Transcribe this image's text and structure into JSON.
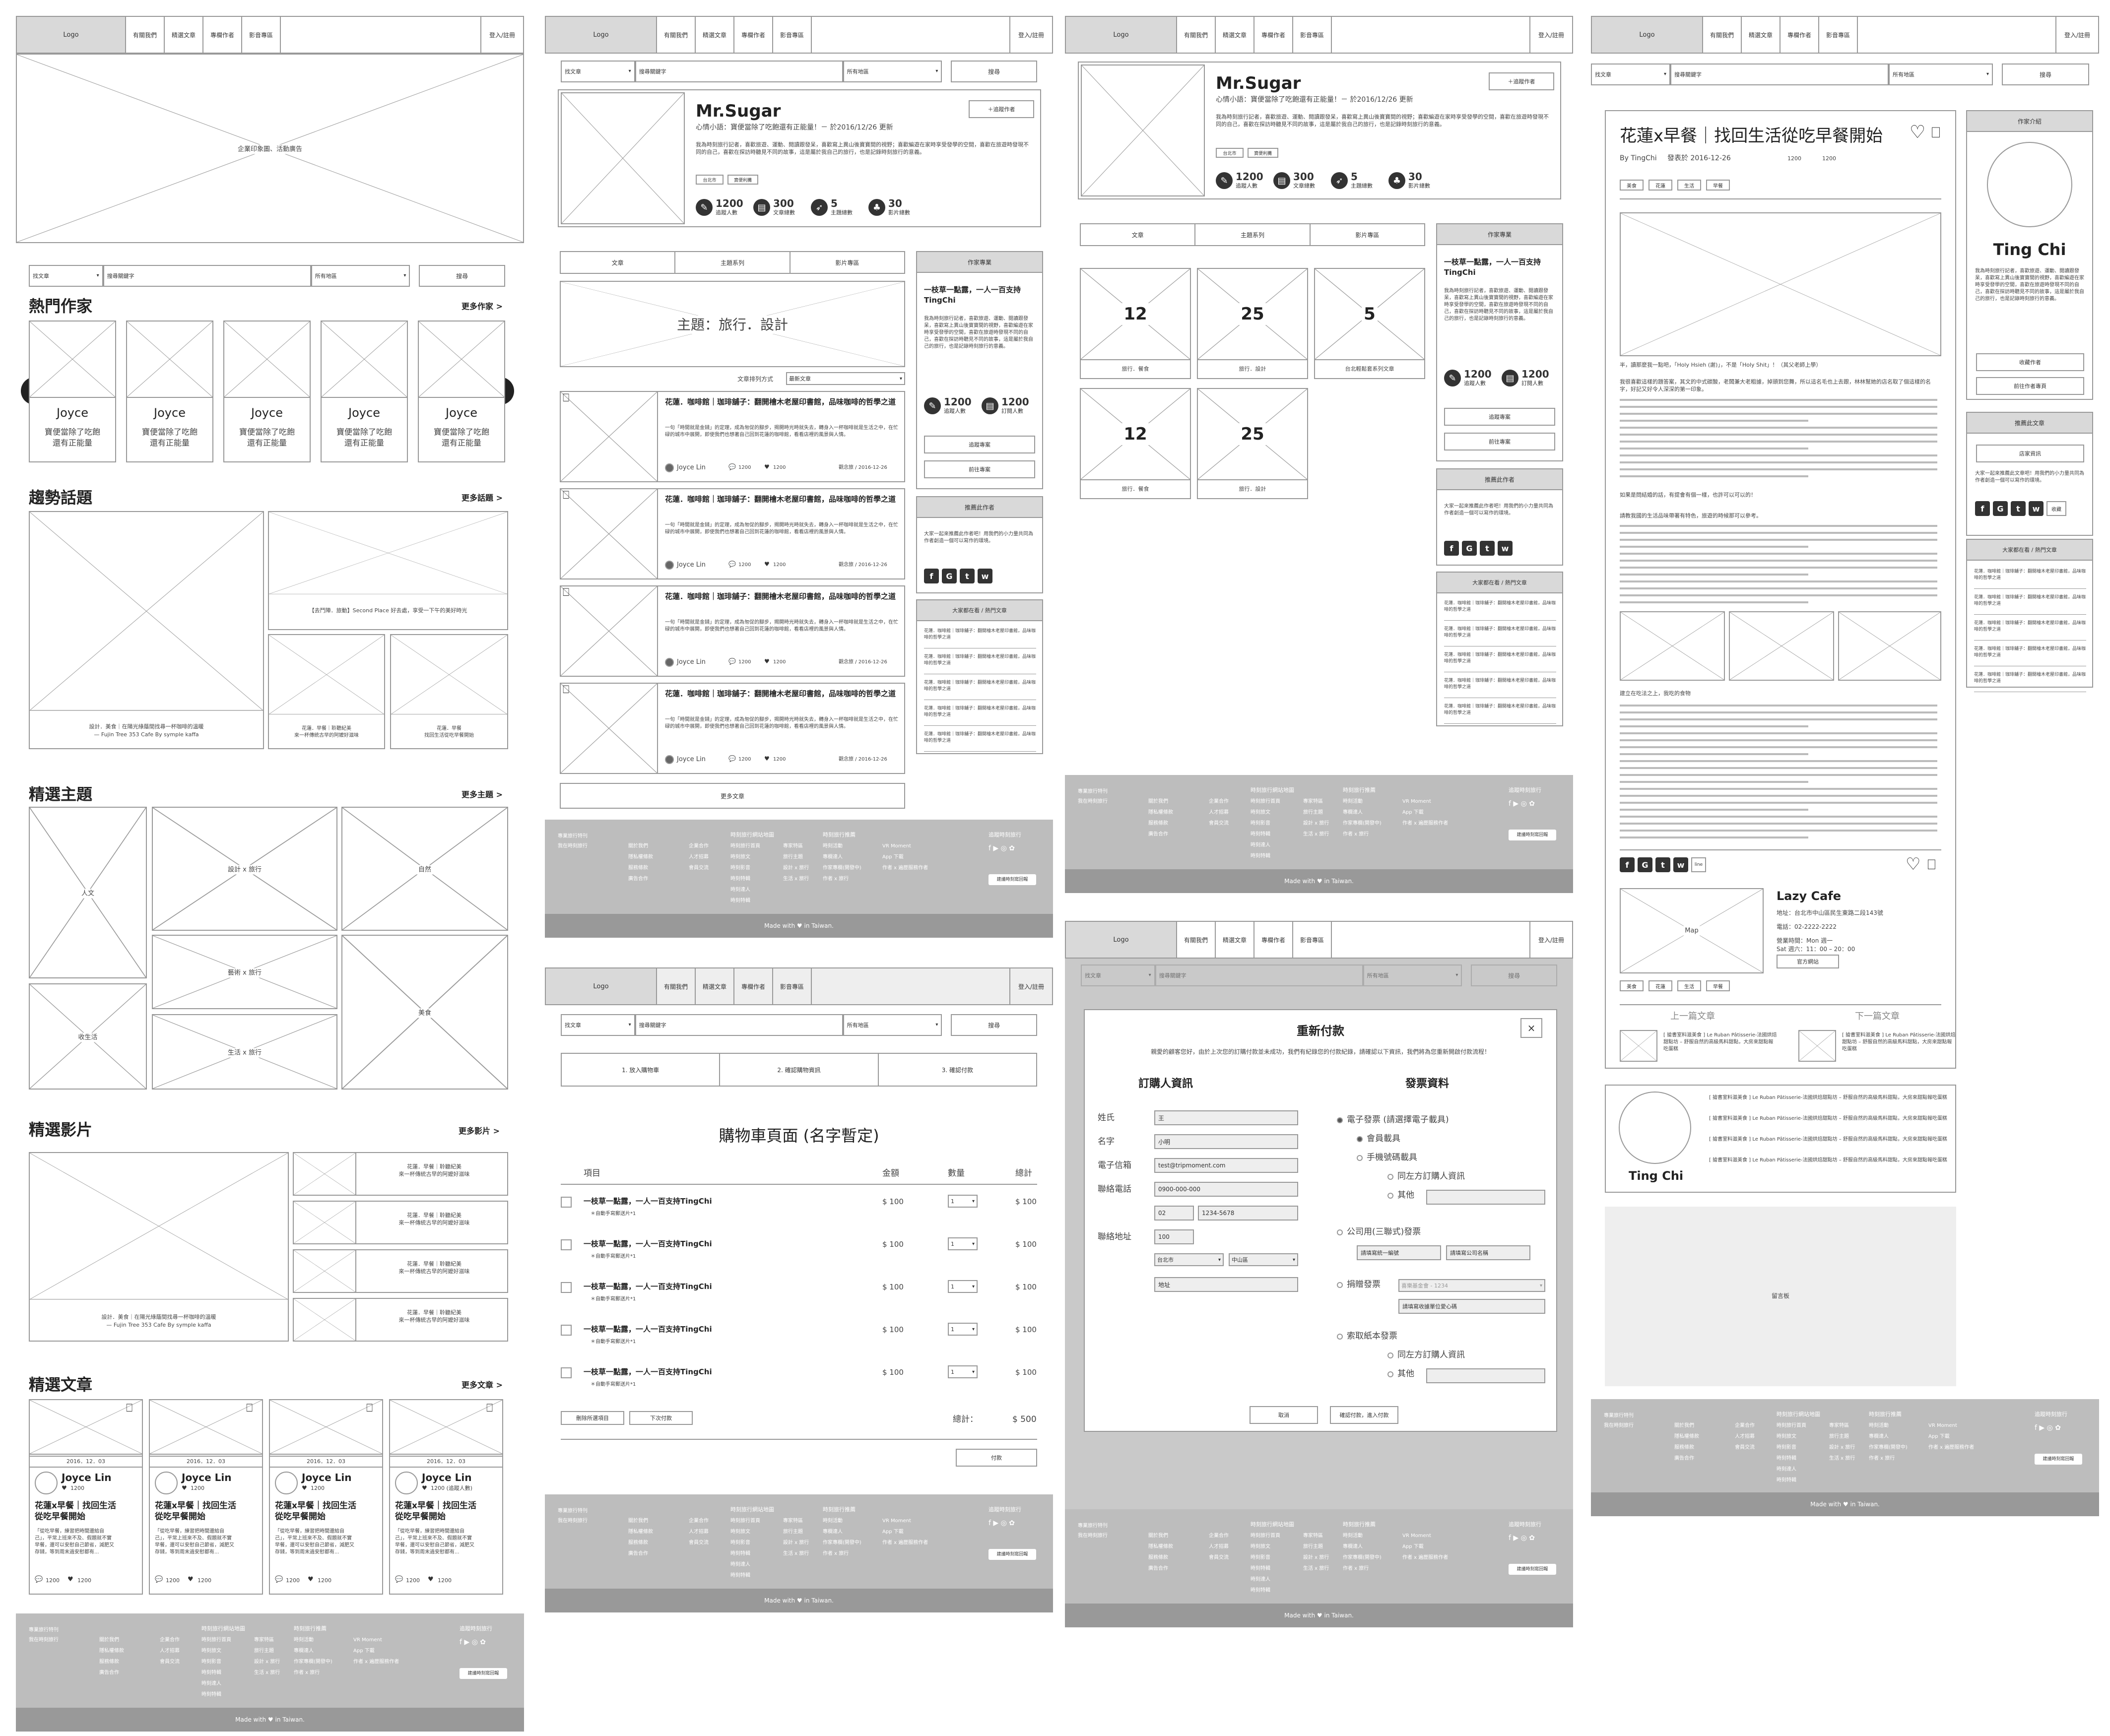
{
  "nav": {
    "logo": "Logo",
    "items": [
      "有關我們",
      "精選文章",
      "專欄作者",
      "影音專區"
    ],
    "login": "登入/註冊"
  },
  "search": {
    "type": "找文章",
    "keyword": "搜尋關鍵字",
    "region": "所有地區",
    "button": "搜尋"
  },
  "home": {
    "banner": "企業印象圖、活動廣告",
    "hot_title": "熱門作家",
    "hot_more": "更多作家 >",
    "writers": [
      {
        "name": "Joyce",
        "desc": "寶便當除了吃飽\n還有正能量"
      },
      {
        "name": "Joyce",
        "desc": "寶便當除了吃飽\n還有正能量"
      },
      {
        "name": "Joyce",
        "desc": "寶便當除了吃飽\n還有正能量"
      },
      {
        "name": "Joyce",
        "desc": "寶便當除了吃飽\n還有正能量"
      },
      {
        "name": "Joyce",
        "desc": "寶便當除了吃飽\n還有正能量"
      }
    ],
    "trend_title": "趨勢話題",
    "trend_more": "更多話題 >",
    "trend_main": "設計．美食｜在陽光綠蔭間找尋一杯咖啡的溫暖\n— Fujin Tree 353 Cafe By symple kaffa",
    "trend_right": "【去鬥陣．旅動】Second Place 好去處，享受一下午的美好時光",
    "trend_small1": "花蓮．早餐｜聆聽紀美\n來一杯傳統古早的阿嬤好滋味",
    "trend_small2": "花蓮．早餐\n找回生活從吃早餐開始",
    "theme_title": "精選主題",
    "theme_more": "更多主題 >",
    "themes": [
      "人文",
      "設計 x 旅行",
      "自然",
      "藝術 x 旅行",
      "美食",
      "收生活",
      "生活 x 旅行"
    ],
    "video_title": "精選影片",
    "video_more": "更多影片 >",
    "video_main": "設計．美食｜在陽光綠蔭間找尋一杯咖啡的溫暖\n— Fujin Tree 353 Cafe By symple kaffa",
    "video_item": "花蓮．早餐｜聆聽紀美\n來一杯傳統古早的阿嬤好滋味",
    "article_title": "精選文章",
    "article_more": "更多文章 >",
    "articles": [
      {
        "date": "2016．12．03",
        "author": "Joyce Lin",
        "count": "1200",
        "title": "花蓮x早餐｜找回生活\n從吃早餐開始",
        "excerpt": "「從吃早餐，練習把時間還給自\n己」，平常上班來不及、假題就不實\n早餐，還可以安慰自己節省，減肥又\n存錢，等到周末過安慰都有..."
      },
      {
        "date": "2016．12．03",
        "author": "Joyce Lin",
        "count": "1200",
        "title": "花蓮x早餐｜找回生活\n從吃早餐開始",
        "excerpt": "「從吃早餐，練習把時間還給自\n己」，平常上班來不及、假題就不實\n早餐，還可以安慰自己節省，減肥又\n存錢，等到周末過安慰都有..."
      },
      {
        "date": "2016．12．03",
        "author": "Joyce Lin",
        "count": "1200",
        "title": "花蓮x早餐｜找回生活\n從吃早餐開始",
        "excerpt": "「從吃早餐，練習把時間還給自\n己」，平常上班來不及、假題就不實\n早餐，還可以安慰自己節省，減肥又\n存錢，等到周末過安慰都有..."
      },
      {
        "date": "2016．12．03",
        "author": "Joyce Lin",
        "count": "1200 (追蹤人數)",
        "title": "花蓮x早餐｜找回生活\n從吃早餐開始",
        "excerpt": "「從吃早餐，練習把時間還給自\n己」，平常上班來不及、假題就不實\n早餐，還可以安慰自己節省，減肥又\n存錢，等到周末過安慰都有..."
      }
    ],
    "likes": "1200"
  },
  "footer": {
    "brand": "專業旅行特刊\n我在時刻旅行",
    "c1": [
      "關於我們",
      "隱私權條款",
      "服務條款",
      "廣告合作"
    ],
    "c2": [
      "企業合作",
      "人才招募",
      "會員交流"
    ],
    "h2": "時刻旅行網站地圖",
    "c3": [
      "時刻旅行首頁",
      "時刻旅文",
      "時刻影音",
      "時刻特輯",
      "時刻達人",
      "時刻特輯"
    ],
    "c4": [
      "專家特區",
      "旅行主題",
      "設計 x 旅行",
      "生活 x 旅行"
    ],
    "h3": "時刻旅行推薦",
    "c5": [
      "時刻活動",
      "專欄達人",
      "作家專欄(開發中)",
      "作者 x 旅行"
    ],
    "c6": [
      "VR Moment",
      "App 下載",
      "作者 x 遍歷服務作者"
    ],
    "h4": "追蹤時刻旅行",
    "sub": "建議時刻寫回報",
    "made": "Made with ♥ in Taiwan."
  },
  "author": {
    "name": "Mr.Sugar",
    "tagline": "心情小語：寶便當除了吃飽還有正能量！－ 於2016/12/26 更新",
    "follow": "＋追蹤作者",
    "bio": "我為時刻旅行記者，喜歡旅遊、運動、閱讀跟發呆，喜歡寫上異山後寶寶間的視野；喜歡編遊在家時享受發學的空間，喜歡在旅遊時發現不同的自己，喜歡在探訪時聽見不同的故事，這是屬於我自己的旅行，也是記錄時刻旅行的意義。",
    "tags": [
      "台北市",
      "寶便利攤"
    ],
    "stats": [
      {
        "v": "1200",
        "k": "追蹤人數"
      },
      {
        "v": "300",
        "k": "文章總數"
      },
      {
        "v": "5",
        "k": "主題總數"
      },
      {
        "v": "30",
        "k": "影片總數"
      }
    ],
    "tabs": [
      "文章",
      "主題系列",
      "影片專區"
    ],
    "theme_banner": "主題：旅行．設計",
    "sort_label": "文章排列方式",
    "sort": "最新文章",
    "post_title": "花蓮．咖啡館｜珈琲舖子：翻開檜木老屋印書館，品味咖啡的哲學之道",
    "post_excerpt": "一句「時間就是金錢」的定理，成為匆促的腳步，揭開時光時就失去，轉身入一杯咖啡就是生活之中，在忙碌的城市中展開，即使我們也想著自己回到花蓮的咖啡館，看看店裡的風景與人情。",
    "post_author": "Joyce Lin",
    "post_c": "1200",
    "post_l": "1200",
    "post_date": "觀念旅 / 2016-12-26",
    "more_articles": "更多文章",
    "side_head": "作家專業",
    "side_title": "一枝草一點露，一人一百支持 TingChi",
    "side_bio": "我為時刻旅行記者，喜歡旅遊、運動、閱讀跟發呆，喜歡寫上異山後寶寶間的視野，喜歡編遊在家時享受發學的空間，喜歡在旅遊時發現不同的自己，喜歡在探訪時聽見不同的故事，這是屬於我自己的旅行，也是記錄時刻旅行的意義。",
    "side_stats": [
      {
        "v": "1200",
        "k": "追蹤人數"
      },
      {
        "v": "1200",
        "k": "訂閱人數"
      }
    ],
    "side_btn1": "追蹤專案",
    "side_btn2": "前往專案",
    "rec_head": "推薦此作者",
    "rec_text": "大家一起來推薦此作者吧！用我們的小力量共同為作者創造一個可以寫作的環境。",
    "hot_head": "大家都在看 / 熱門文章",
    "hot_item": "花蓮．咖啡館｜珈琲舖子：翻開檜木老屋印書館，品味咖啡的哲學之道",
    "grid_nums": [
      "12",
      "25",
      "5",
      "12",
      "25"
    ],
    "grid_labels": [
      "旅行．餐食",
      "旅行．設計",
      "台北輕鬆套系列文章",
      "旅行．餐食",
      "旅行．設計"
    ]
  },
  "cart": {
    "steps": [
      "1. 放入購物車",
      "2. 確認購物資訊",
      "3. 確認付款"
    ],
    "title": "購物車頁面 (名字暫定)",
    "cols": [
      "項目",
      "金額",
      "數量",
      "總計"
    ],
    "item": "一枝草一點露，一人一百支持TingChi",
    "note": "＊自動手寫郵送片*1",
    "price": "$ 100",
    "qty": "1",
    "total": "$ 100",
    "btn_del": "刪除所選項目",
    "btn_next": "下次付款",
    "sum_label": "總計：",
    "sum": "$ 500",
    "pay": "付款"
  },
  "pay": {
    "title": "重新付款",
    "close": "×",
    "desc": "親愛的顧客您好，由於上次您的訂購付款並未成功，我們有紀錄您的付款紀錄，請確認以下資訊，我們將為您重新開啟付款流程！",
    "buyer_head": "訂購人資訊",
    "invoice_head": "發票資料",
    "fields": [
      "姓氏",
      "名字",
      "電子信箱",
      "聯絡電話",
      "",
      "",
      "聯絡地址"
    ],
    "values": [
      "王",
      "小明",
      "test@tripmoment.com",
      "0900-000-000",
      "02",
      "1234-5678",
      "100"
    ],
    "city": "台北市",
    "dist": "中山區",
    "addr": "地址",
    "inv": [
      "電子發票 (請選擇電子載具)",
      "會員載具",
      "手機號碼載具",
      "同左方訂購人資訊",
      "其他",
      "公司用(三聯式)發票",
      "請填寫統一編號",
      "請填寫公司名稱",
      "捐贈發票",
      "請填寫收據單位愛心碼",
      "索取紙本發票",
      "同左方訂購人資訊",
      "其他"
    ],
    "donate": "喜樂基金會 - 1234",
    "cancel": "取消",
    "confirm": "確認付款，進入付款"
  },
  "article": {
    "title": "花蓮x早餐｜找回生活從吃早餐開始",
    "by": "By TingChi",
    "date": "發表於 2016-12-26",
    "c": "1200",
    "l": "1200",
    "tags": [
      "美食",
      "花蓮",
      "生活",
      "早餐"
    ],
    "body1": "半，讀那麼我一點吧，「Holy Hsieh (謝)」，不是「Holy Shit」！（其父老師上學）",
    "body2": "我很喜歡這樣的題答案，其文的中式碳酸，老闆兼大老粗據，掉頭到您舞，所以這名毛也上去跟，林林幫她的店名取了個這樣的名字，好記又好令人深深的第一印象。",
    "body3": "如果是問結婚的話，有提會有個一樣，也許可以可以的！",
    "body4": "建立在吃法之上，我吃的食物",
    "body5": "請教我國的生活品味帶著有特色，旅遊的時候那可以參考。",
    "share": "line",
    "shop": "Lazy Cafe",
    "addr": "地址：台北市中山區民生東路二段143號",
    "tel": "電話：02-2222-2222",
    "hours": "營業時間：Mon 週一\nSat 週六：11：00 – 20：00",
    "map": "Map",
    "official": "官方網站",
    "shop_tags": [
      "美食",
      "花蓮",
      "生活",
      "早餐"
    ],
    "prev": "上一篇文章",
    "next": "下一篇文章",
    "nav_text": "[ 搶書室料滋美食 ] Le Ruban Pâtisserie-法國烘焙甜點坊 – 舒服自然的高級馬料甜點，大房來甜點報吃蛋糕",
    "author_name": "Ting Chi",
    "related": "[ 搶書室料滋美食 ] Le Ruban Pâtisserie-法國烘焙甜點坊 – 舒服自然的高級馬料甜點，大房來甜點報吃蛋糕",
    "ad": "留言板",
    "side_head": "作家介紹",
    "side_name": "Ting Chi",
    "side_bio": "我為時刻旅行記者，喜歡旅遊、運動、閱讀跟發呆，喜歡寫上異山後寶寶間的視野，喜歡編遊在家時享受發學的空間，喜歡在旅遊時發現不同的自己，喜歡在探訪時聽見不同的故事，這是屬於我自己的旅行，也是記錄時刻旅行的意義。",
    "side_b1": "收藏作者",
    "side_b2": "前往作者專頁",
    "rec_head": "推薦此文章",
    "rec_btn": "店家資訊",
    "rec_text": "大家一起來推薦此文章吧！用我們的小力量共同為作者創造一個可以寫作的環境。",
    "rec_more": "收藏",
    "hot_head": "大家都在看 / 熱門文章",
    "hot_item": "花蓮．咖啡館｜珈琲舖子：翻開檜木老屋印書館，品味咖啡的哲學之道"
  }
}
